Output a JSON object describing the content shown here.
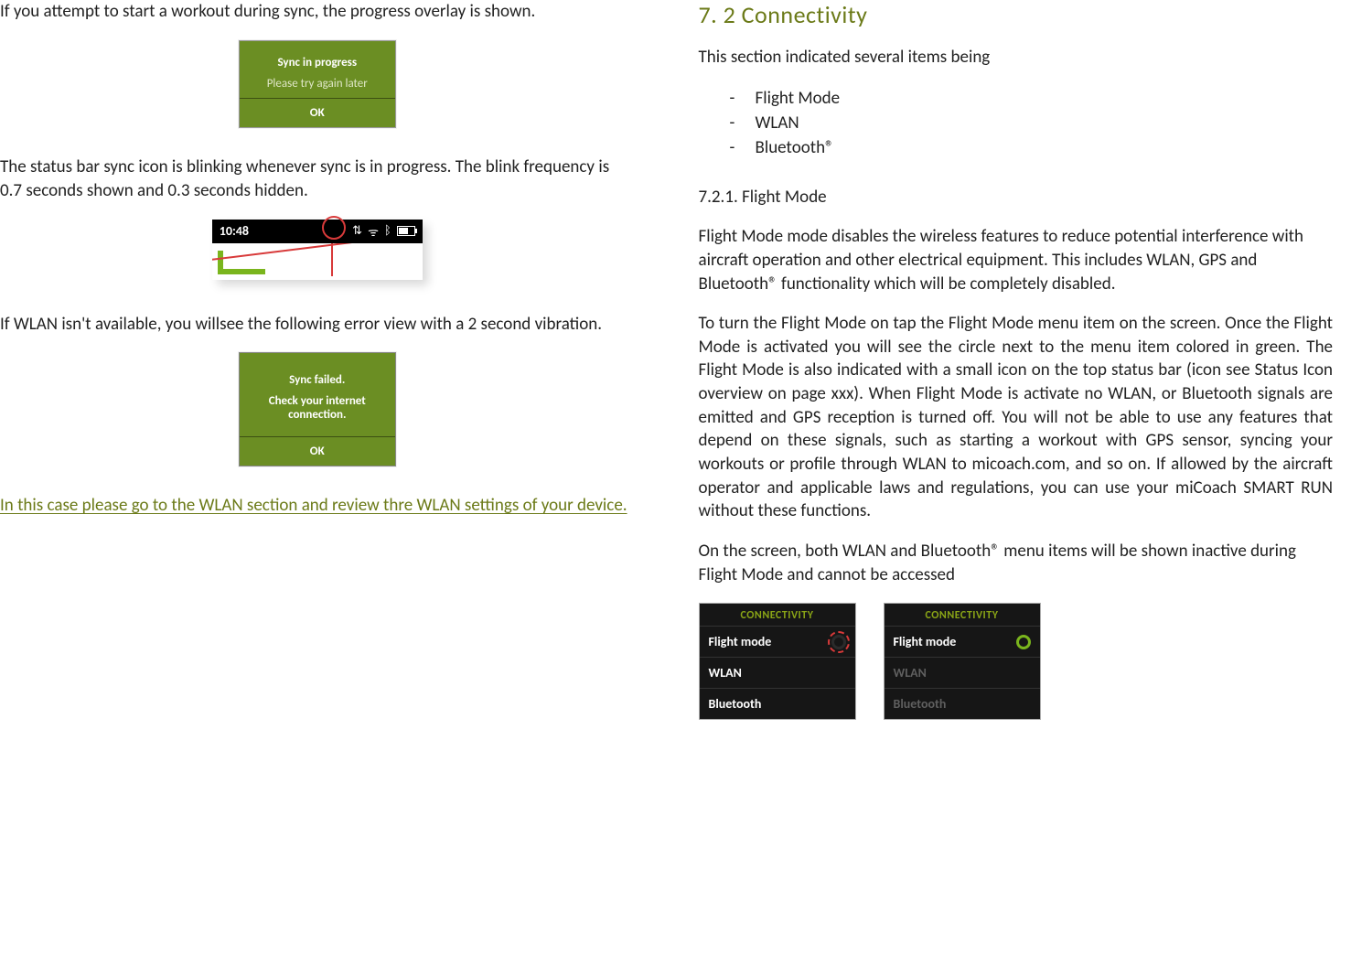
{
  "left": {
    "para_intro": "If you attempt to start a workout during sync, the progress overlay is shown.",
    "dialog1": {
      "line1": "Sync in progress",
      "line2": "Please try again later",
      "ok": "OK"
    },
    "para_status": "The status bar sync icon is blinking whenever sync is in progress. The blink frequency is 0.7 seconds shown and 0.3 seconds hidden.",
    "status_time": "10:48",
    "para_wlan": "If WLAN isn't available, you willsee the following error view with a 2 second vibration.",
    "dialog2": {
      "line1": "Sync failed.",
      "line2": "Check your internet connection.",
      "ok": "OK"
    },
    "para_accent": "In this case please go to the WLAN section and review thre WLAN settings of your device."
  },
  "right": {
    "heading": "7. 2 Connectivity",
    "intro": "This section indicated several items being",
    "bullets": [
      "Flight Mode",
      "WLAN",
      "Bluetooth®"
    ],
    "sub_heading": "7.2.1. Flight Mode",
    "para1": "Flight Mode mode disables the wireless features to reduce potential interference with aircraft operation and other electrical equipment. This includes WLAN, GPS and Bluetooth® functionality which will be completely disabled.",
    "para2": "To turn the Flight Mode on tap the Flight Mode menu item on the screen. Once the Flight Mode is activated you will see the circle next to the menu item colored in green. The Flight Mode is also indicated with a small icon on the top status bar (icon see Status Icon overview on page xxx). When Flight Mode is activate no WLAN, or Bluetooth signals are emitted and GPS reception is turned off. You will not be able to use any features that depend on these signals, such as starting a workout with GPS sensor, syncing your workouts or profile through WLAN to micoach.com, and so on. If allowed by the aircraft operator and applicable laws and regulations, you can use your miCoach SMART RUN without these functions.",
    "para3": "On the screen, both WLAN and Bluetooth® menu items will be shown inactive during Flight Mode and cannot be accessed",
    "conn": {
      "header": "CONNECTIVITY",
      "items": [
        "Flight mode",
        "WLAN",
        "Bluetooth"
      ]
    }
  }
}
